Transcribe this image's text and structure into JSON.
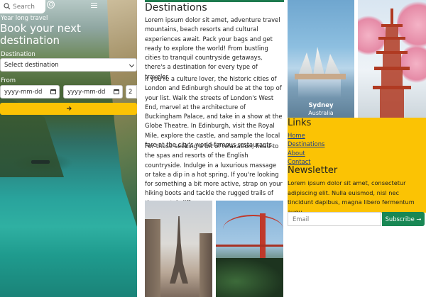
{
  "header": {
    "search_placeholder": "Search"
  },
  "hero": {
    "tagline": "Year long travel",
    "title": "Book your next destination",
    "destination_label": "Destination",
    "destination_value": "Select destination",
    "from_label": "From",
    "from_date_placeholder": "yyyy-mm-dd",
    "to_date_placeholder": "yyyy-mm-dd",
    "guests_value": "2",
    "submit_icon": "arrow-right-icon"
  },
  "main": {
    "title": "Destinations",
    "paragraphs": [
      "Lorem ipsum dolor sit amet, adventure travel mountains, beach resorts and cultural experiences await. Pack your bags and get ready to explore the world! From bustling cities to tranquil countryside getaways, there's a destination for every type of traveler.",
      "If you're a culture lover, the historic cities of London and Edinburgh should be at the top of your list. Walk the streets of London's West End, marvel at the architecture of Buckingham Palace, and take in a show at the Globe Theatre. In Edinburgh, visit the Royal Mile, explore the castle, and sample the local fare at the city's world-famous restaurants.",
      "For those seeking a bit of relaxation, head to the spas and resorts of the English countryside. Indulge in a luxurious massage or take a dip in a hot spring. If you're looking for something a bit more active, strap on your hiking boots and tackle the rugged trails of the coastal cliffs."
    ]
  },
  "cards": [
    {
      "city": "Sydney",
      "country": "Australia"
    }
  ],
  "footer": {
    "links_title": "Links",
    "links": [
      "Home",
      "Destinations",
      "About",
      "Contact"
    ],
    "newsletter_title": "Newsletter",
    "newsletter_text": "Lorem ipsum dolor sit amet, consectetur adipiscing elit. Nulla euismod, nisl nec tincidunt dapibus, magna libero fermentum augu.",
    "email_placeholder": "Email",
    "subscribe_label": "Subscribe →"
  },
  "colors": {
    "accent_yellow": "#fbc304",
    "accent_green": "#198754"
  }
}
